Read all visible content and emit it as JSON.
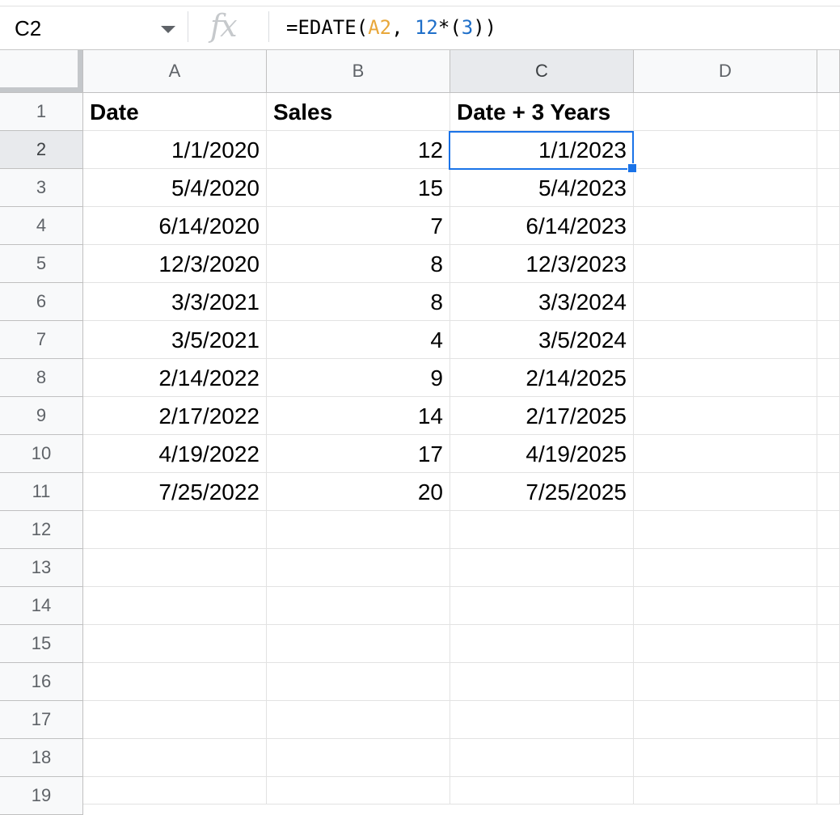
{
  "name_box": {
    "value": "C2"
  },
  "formula": {
    "prefix": "=EDATE(",
    "ref": "A2",
    "sep": ", ",
    "mult": "12",
    "op": "*(",
    "arg": "3",
    "suffix": "))"
  },
  "fx_label": "fx",
  "columns": [
    "A",
    "B",
    "C",
    "D"
  ],
  "rows": [
    "1",
    "2",
    "3",
    "4",
    "5",
    "6",
    "7",
    "8",
    "9",
    "10",
    "11",
    "12",
    "13",
    "14",
    "15",
    "16",
    "17",
    "18",
    "19"
  ],
  "headers": {
    "A": "Date",
    "B": "Sales",
    "C": "Date + 3 Years"
  },
  "data": [
    {
      "date": "1/1/2020",
      "sales": "12",
      "plus3": "1/1/2023"
    },
    {
      "date": "5/4/2020",
      "sales": "15",
      "plus3": "5/4/2023"
    },
    {
      "date": "6/14/2020",
      "sales": "7",
      "plus3": "6/14/2023"
    },
    {
      "date": "12/3/2020",
      "sales": "8",
      "plus3": "12/3/2023"
    },
    {
      "date": "3/3/2021",
      "sales": "8",
      "plus3": "3/3/2024"
    },
    {
      "date": "3/5/2021",
      "sales": "4",
      "plus3": "3/5/2024"
    },
    {
      "date": "2/14/2022",
      "sales": "9",
      "plus3": "2/14/2025"
    },
    {
      "date": "2/17/2022",
      "sales": "14",
      "plus3": "2/17/2025"
    },
    {
      "date": "4/19/2022",
      "sales": "17",
      "plus3": "4/19/2025"
    },
    {
      "date": "7/25/2022",
      "sales": "20",
      "plus3": "7/25/2025"
    }
  ],
  "selected_cell": "C2",
  "colors": {
    "selection": "#1a73e8",
    "ref_token": "#e8a73a",
    "number_token": "#1f6fc9"
  }
}
